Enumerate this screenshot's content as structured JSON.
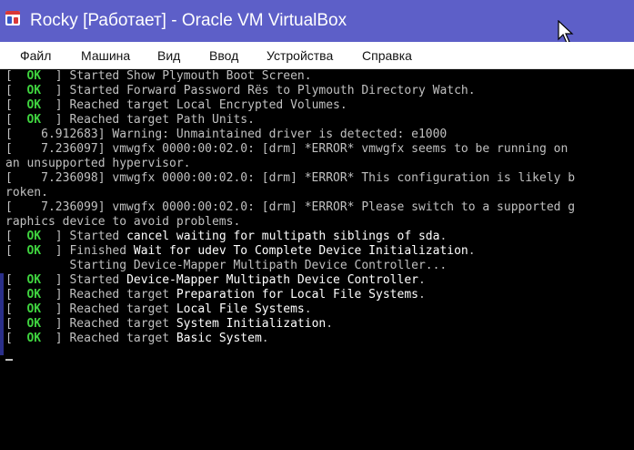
{
  "window": {
    "title": "Rocky [Работает] - Oracle VM VirtualBox",
    "icon": "virtualbox-app-icon"
  },
  "colors": {
    "titlebar": "#5d5fc8",
    "console_bg": "#000000",
    "console_text": "#c0c0c0",
    "ok_green": "#3fd33f"
  },
  "menu": {
    "items": [
      {
        "label": "Файл"
      },
      {
        "label": "Машина"
      },
      {
        "label": "Вид"
      },
      {
        "label": "Ввод"
      },
      {
        "label": "Устройства"
      },
      {
        "label": "Справка"
      }
    ]
  },
  "console": {
    "lines": [
      {
        "status": "OK",
        "action": "Started",
        "target": "Show Plymouth Boot Screen",
        "end": "."
      },
      {
        "status": "OK",
        "action": "Started",
        "target": "Forward Password Rёs to Plymouth Directory Watch",
        "end": "."
      },
      {
        "status": "OK",
        "action": "Reached target",
        "target": "Local Encrypted Volumes",
        "end": "."
      },
      {
        "status": "OK",
        "action": "Reached target",
        "target": "Path Units",
        "end": "."
      },
      {
        "text": "[    6.912683] Warning: Unmaintained driver is detected: e1000"
      },
      {
        "text": "[    7.236097] vmwgfx 0000:00:02.0: [drm] *ERROR* vmwgfx seems to be running on"
      },
      {
        "text": "an unsupported hypervisor."
      },
      {
        "text": "[    7.236098] vmwgfx 0000:00:02.0: [drm] *ERROR* This configuration is likely b"
      },
      {
        "text": "roken."
      },
      {
        "text": "[    7.236099] vmwgfx 0000:00:02.0: [drm] *ERROR* Please switch to a supported g"
      },
      {
        "text": "raphics device to avoid problems."
      },
      {
        "status": "OK",
        "action": "Started",
        "target": "cancel waiting for multipath siblings of sda",
        "end": ".",
        "hl": true
      },
      {
        "status": "OK",
        "action": "Finished",
        "target": "Wait for udev To Complete Device Initialization",
        "end": ".",
        "hl": true
      },
      {
        "text": "         Starting Device-Mapper Multipath Device Controller..."
      },
      {
        "status": "OK",
        "action": "Started",
        "target": "Device-Mapper Multipath Device Controller",
        "end": ".",
        "hl": true
      },
      {
        "status": "OK",
        "action": "Reached target",
        "target": "Preparation for Local File Systems",
        "end": ".",
        "hl": true
      },
      {
        "status": "OK",
        "action": "Reached target",
        "target": "Local File Systems",
        "end": ".",
        "hl": true
      },
      {
        "status": "OK",
        "action": "Reached target",
        "target": "System Initialization",
        "end": ".",
        "hl": true
      },
      {
        "status": "OK",
        "action": "Reached target",
        "target": "Basic System",
        "end": ".",
        "hl": true
      }
    ]
  }
}
